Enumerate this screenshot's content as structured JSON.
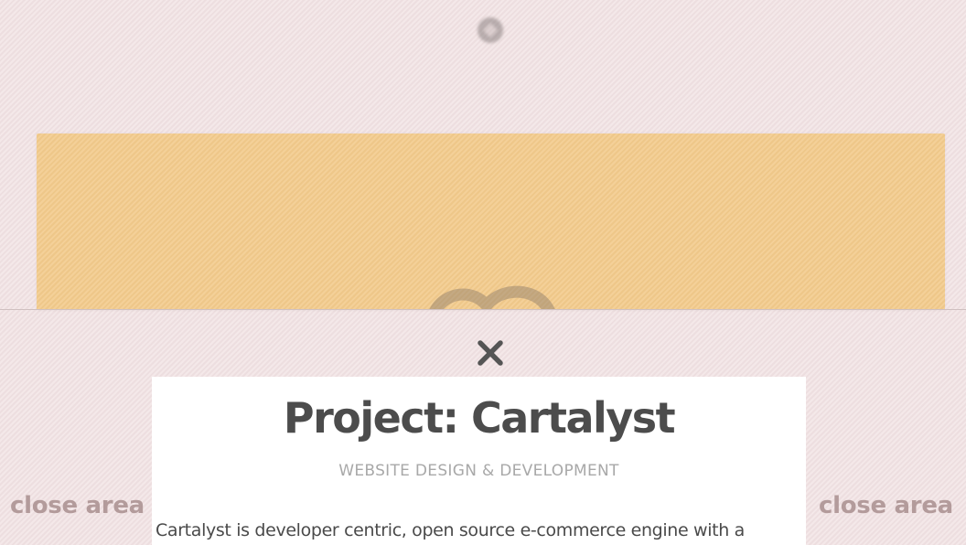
{
  "header": {
    "logo_icon": "logo-icon"
  },
  "banner": {
    "color": "#f3cb8c",
    "art_icon": "project-art"
  },
  "modal": {
    "close_icon": "close-icon",
    "close_area_left": "close area",
    "close_area_right": "close area",
    "title": "Project: Cartalyst",
    "subtitle": "WEBSITE DESIGN & DEVELOPMENT",
    "description": "Cartalyst is developer centric, open source e-commerce engine with a"
  },
  "colors": {
    "background": "#f1e2e3",
    "close_area_text": "#b39b9b",
    "title_text": "#4c4c4c",
    "subtitle_text": "#a8a8a8"
  }
}
